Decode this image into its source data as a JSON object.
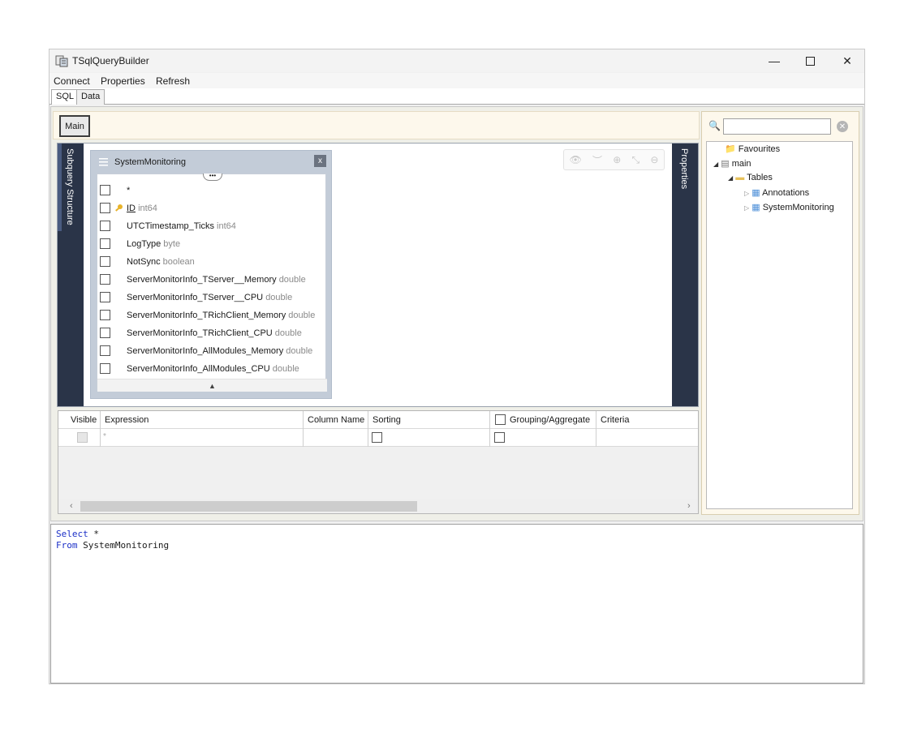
{
  "window": {
    "title": "TSqlQueryBuilder"
  },
  "menu": {
    "items": [
      "Connect",
      "Properties",
      "Refresh"
    ]
  },
  "tabs": [
    {
      "label": "SQL",
      "active": true
    },
    {
      "label": "Data",
      "active": false
    }
  ],
  "builder": {
    "main_button": "Main",
    "left_panel_label": "Subquery Structure",
    "right_panel_label": "Properties",
    "table": {
      "name": "SystemMonitoring",
      "close_label": "x",
      "more_label": "•••",
      "fields": [
        {
          "name": "*",
          "type": ""
        },
        {
          "name": "ID",
          "type": "int64",
          "key": true
        },
        {
          "name": "UTCTimestamp_Ticks",
          "type": "int64"
        },
        {
          "name": "LogType",
          "type": "byte"
        },
        {
          "name": "NotSync",
          "type": "boolean"
        },
        {
          "name": "ServerMonitorInfo_TServer__Memory",
          "type": "double"
        },
        {
          "name": "ServerMonitorInfo_TServer__CPU",
          "type": "double"
        },
        {
          "name": "ServerMonitorInfo_TRichClient_Memory",
          "type": "double"
        },
        {
          "name": "ServerMonitorInfo_TRichClient_CPU",
          "type": "double"
        },
        {
          "name": "ServerMonitorInfo_AllModules_Memory",
          "type": "double"
        },
        {
          "name": "ServerMonitorInfo_AllModules_CPU",
          "type": "double"
        }
      ]
    }
  },
  "grid": {
    "columns": [
      "Visible",
      "Expression",
      "Column Name",
      "Sorting",
      "Grouping/Aggregate",
      "Criteria"
    ],
    "row": {
      "expression": "*"
    }
  },
  "tree": {
    "search_placeholder": "",
    "items": {
      "favourites": "Favourites",
      "main": "main",
      "tables": "Tables",
      "annotations": "Annotations",
      "system_monitoring": "SystemMonitoring"
    }
  },
  "sql": {
    "line1_kw": "Select",
    "line1_rest": " *",
    "line2_kw": "From",
    "line2_rest": " SystemMonitoring"
  },
  "colors": {
    "panel_dark": "#2a3448",
    "keyword_blue": "#1b2fc7",
    "strip_bg": "#fdf8ec"
  }
}
